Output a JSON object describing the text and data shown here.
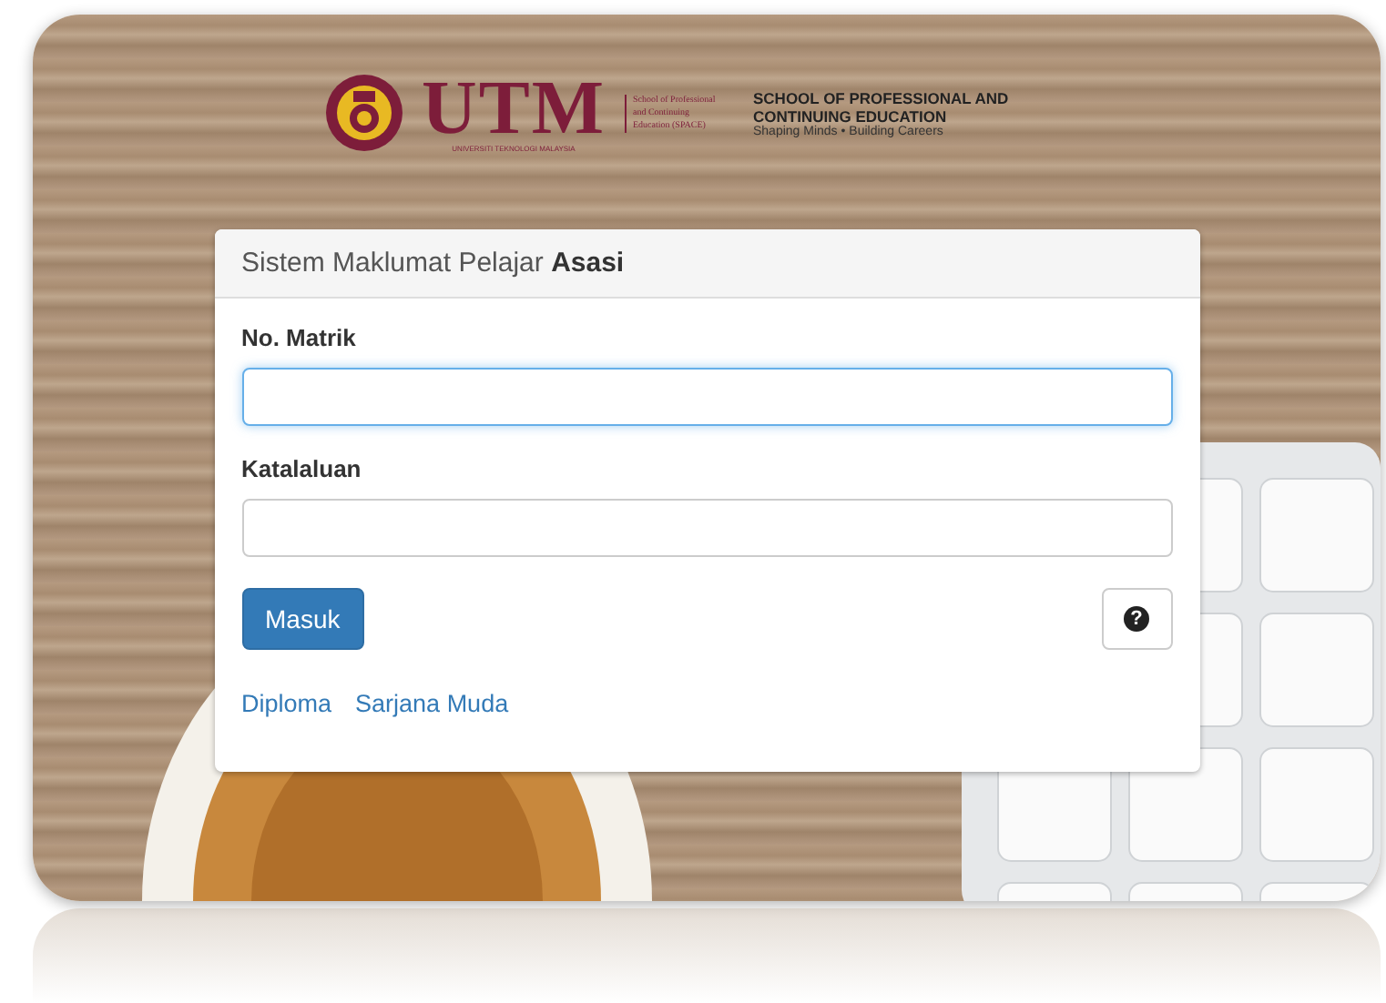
{
  "header": {
    "logo_text": "UTM",
    "university": "UNIVERSITI TEKNOLOGI MALAYSIA",
    "unit": "School of Professional and Continuing Education (SPACE)",
    "school_name": "SCHOOL OF PROFESSIONAL AND CONTINUING EDUCATION",
    "tagline": "Shaping Minds • Building Careers"
  },
  "panel": {
    "title": "Sistem Maklumat Pelajar **Asasi**",
    "fields": [
      {
        "label": "No. Matrik",
        "focused": true
      },
      {
        "label": "Katalaluan",
        "focused": false
      }
    ],
    "submit": "Masuk",
    "help": "?",
    "links": [
      "Diploma",
      "Sarjana Muda"
    ]
  }
}
